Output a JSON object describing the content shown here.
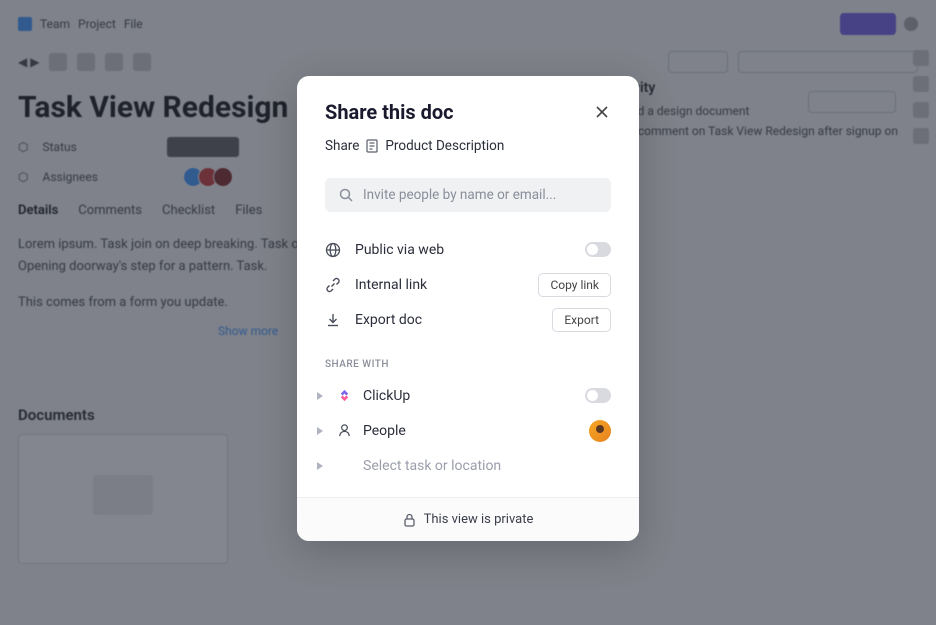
{
  "bg": {
    "breadcrumb": [
      "Team",
      "Project",
      "File"
    ],
    "title": "Task View Redesign",
    "meta_status": "Status",
    "meta_assignees": "Assignees",
    "tabs": [
      "Details",
      "Comments",
      "Checklist",
      "Files"
    ],
    "body": "Lorem ipsum. Task join on deep breaking. Task opens the descriptive pattern done. Opening doorway's step for a pattern. Task.",
    "body2": "This comes from a form you update.",
    "show_more": "Show more",
    "documents": "Documents",
    "right_title": "Activity",
    "right_sub1": "shared a design document",
    "right_sub2": "left a comment on Task View Redesign after signup on"
  },
  "modal": {
    "title": "Share this doc",
    "breadcrumb_share": "Share",
    "breadcrumb_doc": "Product Description",
    "search_placeholder": "Invite people by name or email...",
    "options": {
      "public": "Public via web",
      "internal": "Internal link",
      "copy_link": "Copy link",
      "export": "Export doc",
      "export_btn": "Export"
    },
    "section_label": "SHARE WITH",
    "share_with": {
      "clickup": "ClickUp",
      "people": "People",
      "select_task": "Select task or location"
    },
    "footer": "This view is private"
  }
}
